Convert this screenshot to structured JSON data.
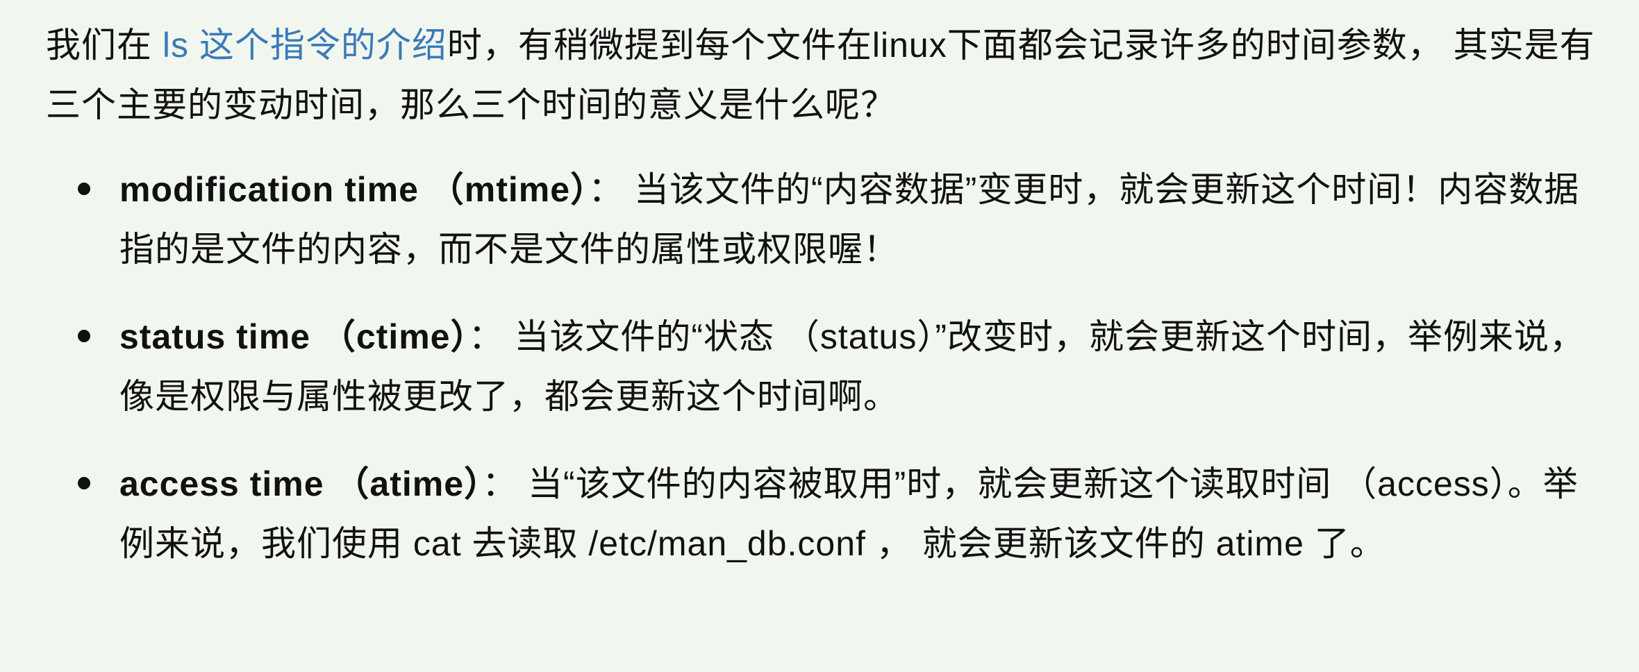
{
  "intro": {
    "before_link": "我们在 ",
    "link_text": "ls 这个指令的介绍",
    "after_link": "时，有稍微提到每个文件在linux下面都会记录许多的时间参数， 其实是有三个主要的变动时间，那么三个时间的意义是什么呢？"
  },
  "items": [
    {
      "term": "modification time （mtime）",
      "desc": "： 当该文件的“内容数据”变更时，就会更新这个时间！内容数据指的是文件的内容，而不是文件的属性或权限喔！"
    },
    {
      "term": "status time （ctime）",
      "desc": "： 当该文件的“状态 （status）”改变时，就会更新这个时间，举例来说，像是权限与属性被更改了，都会更新这个时间啊。"
    },
    {
      "term": "access time （atime）",
      "desc": "： 当“该文件的内容被取用”时，就会更新这个读取时间 （access）。举例来说，我们使用 cat 去读取 /etc/man_db.conf ， 就会更新该文件的 atime 了。"
    }
  ],
  "colors": {
    "background": "#f1f6ef",
    "text": "#111111",
    "link": "#3a7ab7"
  }
}
